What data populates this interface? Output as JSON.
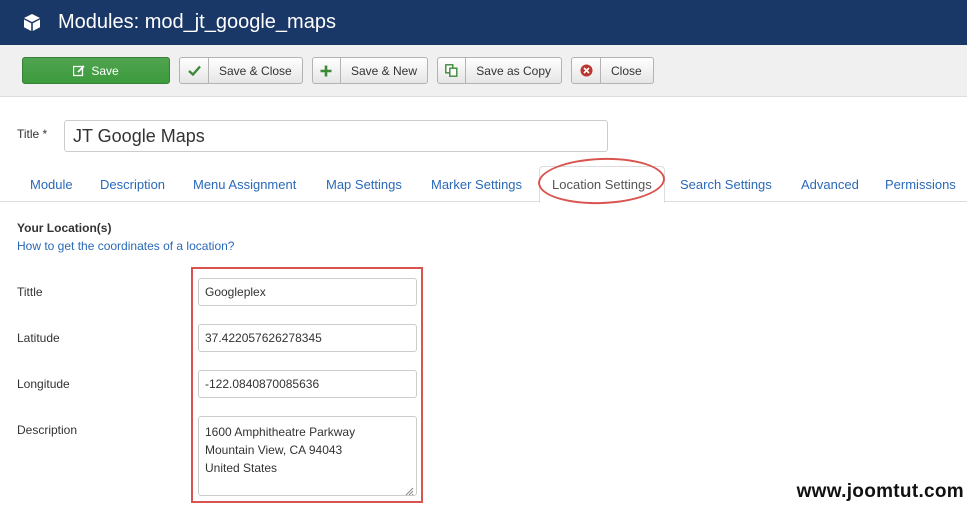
{
  "header": {
    "title": "Modules: mod_jt_google_maps",
    "icon": "cube-icon"
  },
  "toolbar": {
    "save": {
      "label": "Save",
      "icon": "edit-icon"
    },
    "save_close": {
      "label": "Save & Close",
      "icon": "check-icon"
    },
    "save_new": {
      "label": "Save & New",
      "icon": "plus-icon"
    },
    "save_copy": {
      "label": "Save as Copy",
      "icon": "copy-icon"
    },
    "close": {
      "label": "Close",
      "icon": "close-circle-icon"
    }
  },
  "form": {
    "title_label": "Title *",
    "title_value": "JT Google Maps"
  },
  "tabs": [
    {
      "label": "Module"
    },
    {
      "label": "Description"
    },
    {
      "label": "Menu Assignment"
    },
    {
      "label": "Map Settings"
    },
    {
      "label": "Marker Settings"
    },
    {
      "label": "Location Settings",
      "active": true
    },
    {
      "label": "Search Settings"
    },
    {
      "label": "Advanced"
    },
    {
      "label": "Permissions"
    }
  ],
  "location": {
    "section_title": "Your Location(s)",
    "help_link": "How to get the coordinates of a location?",
    "fields": {
      "title": {
        "label": "Tittle",
        "value": "Googleplex"
      },
      "latitude": {
        "label": "Latitude",
        "value": "37.422057626278345"
      },
      "longitude": {
        "label": "Longitude",
        "value": "-122.0840870085636"
      },
      "description": {
        "label": "Description",
        "lines": [
          "1600 Amphitheatre Parkway",
          "Mountain View, CA 94043",
          "United States"
        ]
      }
    }
  },
  "watermark": "www.joomtut.com",
  "colors": {
    "header_bg": "#1a3867",
    "save_green": "#46a546",
    "link_blue": "#2a69b8",
    "highlight_red": "#d9534f"
  }
}
